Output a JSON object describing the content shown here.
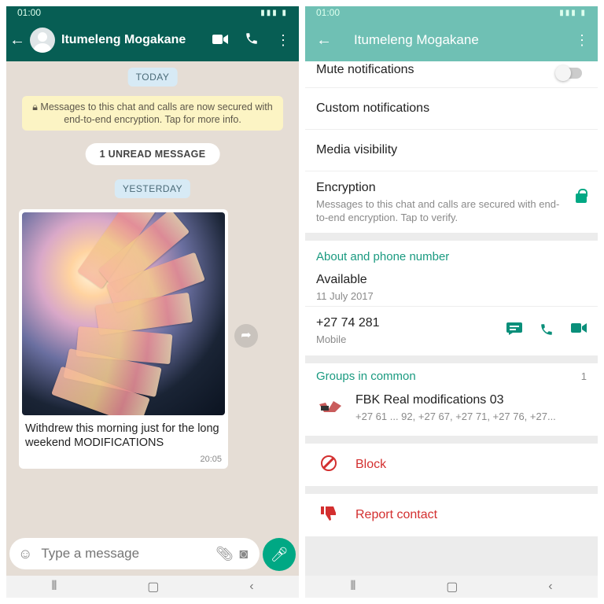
{
  "status": {
    "time": "01:00"
  },
  "left": {
    "contact_name": "Itumeleng Mogakane",
    "today_label": "TODAY",
    "encryption_notice": "Messages to this chat and calls are now secured with end-to-end encryption. Tap for more info.",
    "unread_label": "1 UNREAD MESSAGE",
    "yesterday_label": "YESTERDAY",
    "message": {
      "caption": "Withdrew this morning just for the long weekend MODIFICATIONS",
      "time": "20:05"
    },
    "input_placeholder": "Type a message"
  },
  "right": {
    "contact_name": "Itumeleng Mogakane",
    "mute_label": "Mute notifications",
    "mute_on": false,
    "custom_label": "Custom notifications",
    "media_label": "Media visibility",
    "encryption": {
      "title": "Encryption",
      "desc": "Messages to this chat and calls are secured with end-to-end encryption. Tap to verify."
    },
    "about_title": "About and phone number",
    "about_status": "Available",
    "about_date": "11 July 2017",
    "phone": "+27 74 281 ",
    "phone_type": "Mobile",
    "groups_title": "Groups in common",
    "groups_count": "1",
    "group": {
      "name": "FBK Real modifications 03",
      "members": "+27 61 ... 92, +27 67, +27 71, +27 76, +27..."
    },
    "block_label": "Block",
    "report_label": "Report contact"
  },
  "colors": {
    "header_dark": "#075e54",
    "header_light": "#6fc0b4",
    "accent": "#00a884",
    "danger": "#d32f2f"
  }
}
